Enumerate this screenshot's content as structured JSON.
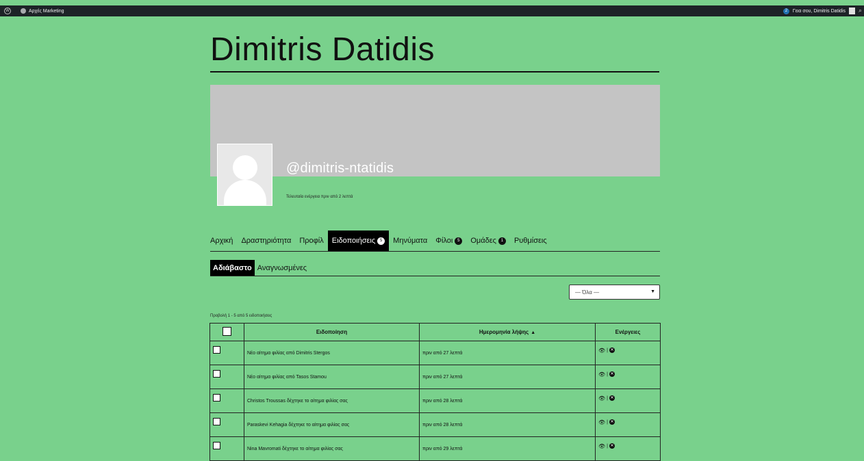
{
  "adminbar": {
    "site_name": "Αρχές Marketing",
    "notifications_count": "2",
    "greeting": "Γεια σου, Dimitris Datidis"
  },
  "site": {
    "title": "Dimitris Datidis"
  },
  "profile": {
    "handle": "@dimitris-ntatidis",
    "last_active": "Τελευταία ενέργεια πριν από 2 λεπτά"
  },
  "main_nav": [
    {
      "label": "Αρχική",
      "count": ""
    },
    {
      "label": "Δραστηριότητα",
      "count": ""
    },
    {
      "label": "Προφίλ",
      "count": ""
    },
    {
      "label": "Ειδοποιήσεις",
      "count": "5",
      "current": true
    },
    {
      "label": "Μηνύματα",
      "count": ""
    },
    {
      "label": "Φίλοι",
      "count": "5"
    },
    {
      "label": "Ομάδες",
      "count": "1"
    },
    {
      "label": "Ρυθμίσεις",
      "count": ""
    }
  ],
  "sub_nav": [
    {
      "label": "Αδιάβαστο",
      "current": true
    },
    {
      "label": "Αναγνωσμένες"
    }
  ],
  "filter": {
    "selected": "— Όλα —"
  },
  "pagination_count": "Προβολή 1 - 5 από 5 ειδοποιήσεις",
  "table": {
    "headers": {
      "notification": "Ειδοποίηση",
      "date": "Ημερομηνία λήψης",
      "date_sort": "▲",
      "actions": "Ενέργειες"
    },
    "rows": [
      {
        "text": "Νέο αίτημα φιλίας από Dimitris Stergos",
        "date": "πριν από 27 λεπτά"
      },
      {
        "text": "Νέο αίτημα φιλίας από Tasos Stamou",
        "date": "πριν από 27 λεπτά"
      },
      {
        "text": "Christos Troussas δέχτηκε το αίτημα φιλίας σας",
        "date": "πριν από 28 λεπτά"
      },
      {
        "text": "Paraskevi Kehagia δέχτηκε το αίτημα φιλίας σας",
        "date": "πριν από 28 λεπτά"
      },
      {
        "text": "Nina Mavromati δέχτηκε το αίτημα φιλίας σας",
        "date": "πριν από 29 λεπτά"
      }
    ],
    "action_separator": "|"
  },
  "colors": {
    "background": "#79d18c",
    "adminbar": "#1d2327",
    "cover": "#c4c4c4",
    "accent": "#000000"
  },
  "icons": {
    "wp_logo": "wordpress-icon",
    "view": "eye-icon",
    "delete": "x-circle-icon",
    "search": "search-icon"
  }
}
